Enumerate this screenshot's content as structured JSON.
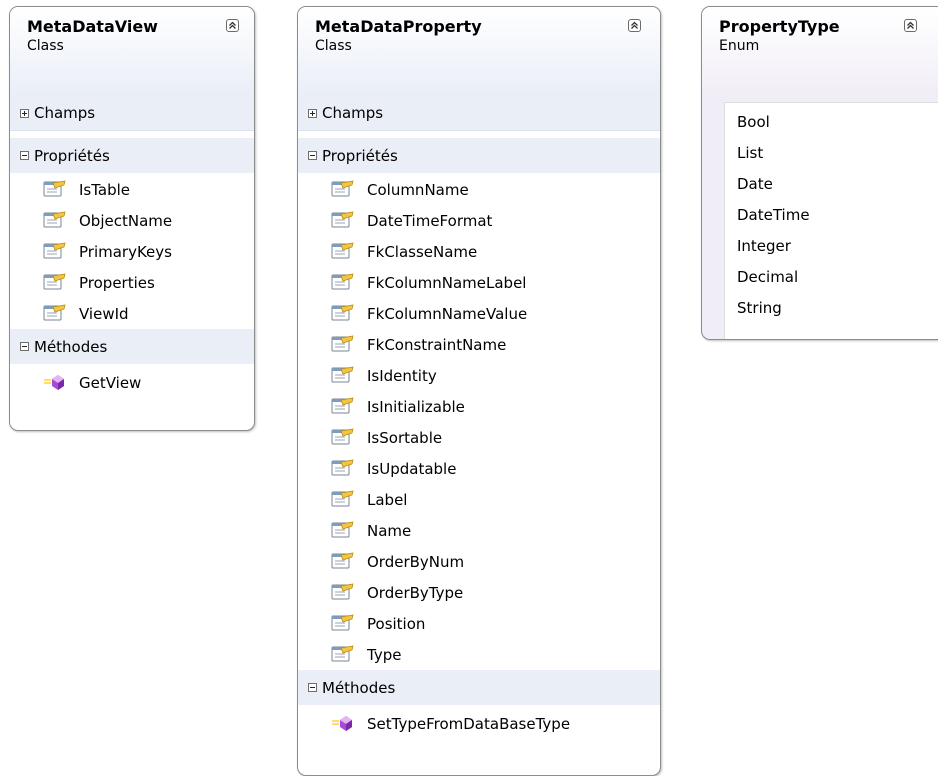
{
  "colors": {
    "header_gradient_end": "#e9eef7",
    "section_band": "#eaeef6",
    "enum_band": "#f1edf7",
    "border": "#8c8c8c"
  },
  "classes": [
    {
      "name": "MetaDataView",
      "stereotype": "Class",
      "collapse_icon": "double-chevron-up-icon",
      "sections": {
        "fields": {
          "label": "Champs",
          "expander": "plus",
          "items": []
        },
        "properties": {
          "label": "Propriétés",
          "expander": "minus",
          "icon": "property-icon",
          "items": [
            "IsTable",
            "ObjectName",
            "PrimaryKeys",
            "Properties",
            "ViewId"
          ]
        },
        "methods": {
          "label": "Méthodes",
          "expander": "minus",
          "icon": "method-icon",
          "items": [
            "GetView"
          ]
        }
      }
    },
    {
      "name": "MetaDataProperty",
      "stereotype": "Class",
      "collapse_icon": "double-chevron-up-icon",
      "sections": {
        "fields": {
          "label": "Champs",
          "expander": "plus",
          "items": []
        },
        "properties": {
          "label": "Propriétés",
          "expander": "minus",
          "icon": "property-icon",
          "items": [
            "ColumnName",
            "DateTimeFormat",
            "FkClasseName",
            "FkColumnNameLabel",
            "FkColumnNameValue",
            "FkConstraintName",
            "IsIdentity",
            "IsInitializable",
            "IsSortable",
            "IsUpdatable",
            "Label",
            "Name",
            "OrderByNum",
            "OrderByType",
            "Position",
            "Type"
          ]
        },
        "methods": {
          "label": "Méthodes",
          "expander": "minus",
          "icon": "method-icon",
          "items": [
            "SetTypeFromDataBaseType"
          ]
        }
      }
    }
  ],
  "enum": {
    "name": "PropertyType",
    "stereotype": "Enum",
    "collapse_icon": "double-chevron-up-icon",
    "values": [
      "Bool",
      "List",
      "Date",
      "DateTime",
      "Integer",
      "Decimal",
      "String"
    ]
  }
}
